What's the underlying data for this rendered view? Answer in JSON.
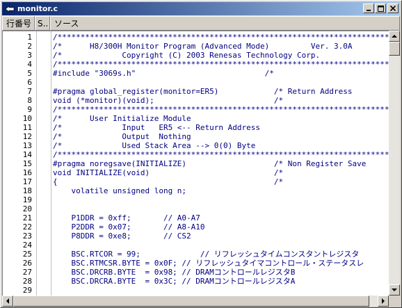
{
  "window": {
    "title": "monitor.c"
  },
  "columns": {
    "line_number": "行番号",
    "s": "S..",
    "source": "ソース"
  },
  "lines": [
    {
      "no": "1",
      "text": "/****************************************************************************"
    },
    {
      "no": "2",
      "text": "/*      H8/300H Monitor Program (Advanced Mode)         Ver. 3.0A"
    },
    {
      "no": "3",
      "text": "/*             Copyright (C) 2003 Renesas Technology Corp."
    },
    {
      "no": "4",
      "text": "/****************************************************************************"
    },
    {
      "no": "5",
      "text": "#include \"3069s.h\"                            /*"
    },
    {
      "no": "6",
      "text": ""
    },
    {
      "no": "7",
      "text": "#pragma global_register(monitor=ER5)            /* Return Address"
    },
    {
      "no": "8",
      "text": "void (*monitor)(void);                          /*"
    },
    {
      "no": "9",
      "text": "/****************************************************************************"
    },
    {
      "no": "10",
      "text": "/*      User Initialize Module"
    },
    {
      "no": "11",
      "text": "/*             Input   ER5 <-- Return Address"
    },
    {
      "no": "12",
      "text": "/*             Output  Nothing"
    },
    {
      "no": "13",
      "text": "/*             Used Stack Area --> 0(0) Byte"
    },
    {
      "no": "14",
      "text": "/****************************************************************************"
    },
    {
      "no": "15",
      "text": "#pragma noregsave(INITIALIZE)                   /* Non Register Save"
    },
    {
      "no": "16",
      "text": "void INITIALIZE(void)                           /*"
    },
    {
      "no": "17",
      "text": "{                                               /*"
    },
    {
      "no": "18",
      "text": "    volatile unsigned long n;"
    },
    {
      "no": "19",
      "text": ""
    },
    {
      "no": "20",
      "text": ""
    },
    {
      "no": "21",
      "text": "    P1DDR = 0xff;       // A0-A7"
    },
    {
      "no": "22",
      "text": "    P2DDR = 0x07;       // A8-A10"
    },
    {
      "no": "23",
      "text": "    P8DDR = 0xe8;       // CS2"
    },
    {
      "no": "24",
      "text": ""
    },
    {
      "no": "25",
      "text": "    BSC.RTCOR = 99;             // リフレッシュタイムコンスタントレジスタ"
    },
    {
      "no": "26",
      "text": "    BSC.RTMCSR.BYTE = 0x0F; // リフレッシュタイマコントロール・ステータスレ"
    },
    {
      "no": "27",
      "text": "    BSC.DRCRB.BYTE  = 0x98; // DRAMコントロールレジスタB"
    },
    {
      "no": "28",
      "text": "    BSC.DRCRA.BYTE  = 0x3C; // DRAMコントロールレジスタA"
    },
    {
      "no": "29",
      "text": ""
    }
  ]
}
